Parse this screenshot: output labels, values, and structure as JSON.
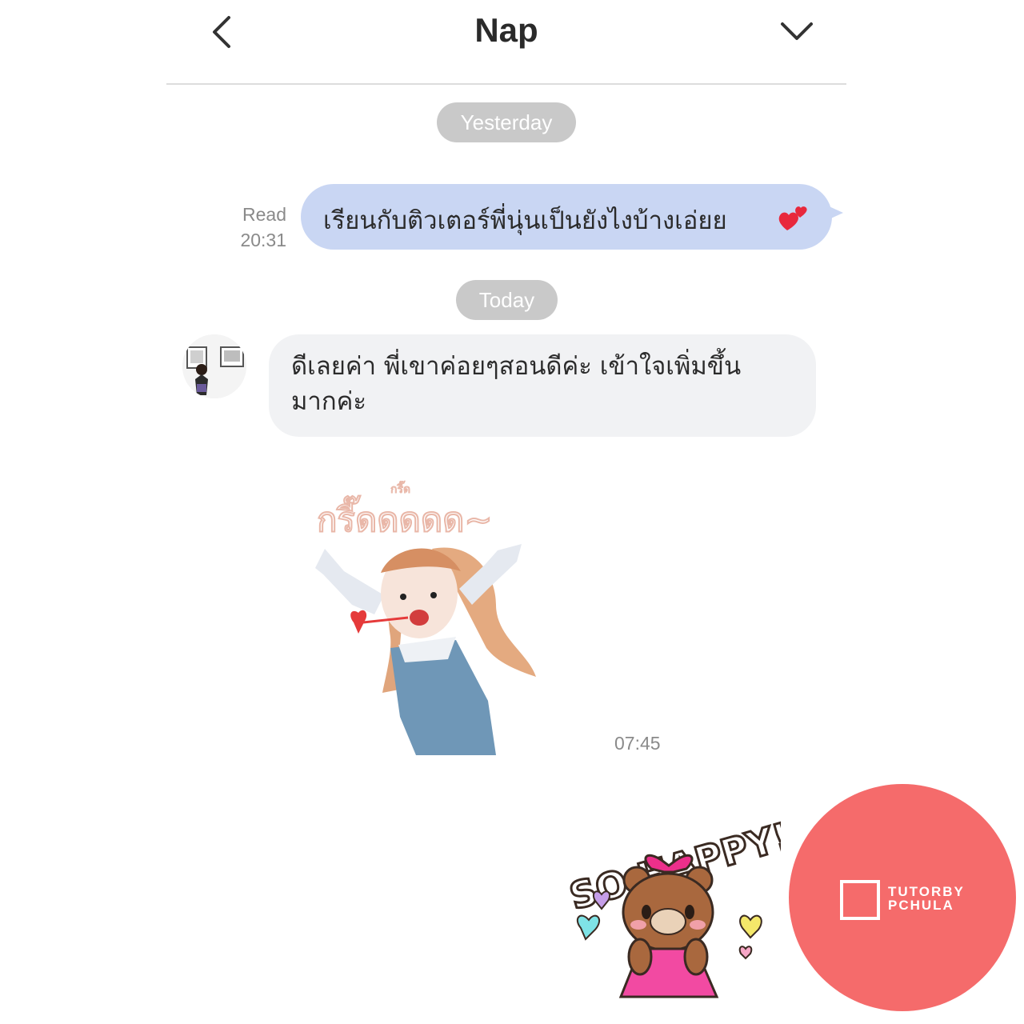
{
  "header": {
    "title": "Nap"
  },
  "dates": {
    "yesterday": "Yesterday",
    "today": "Today"
  },
  "outgoing": {
    "read_label": "Read",
    "time": "20:31",
    "text": "เรียนกับติวเตอร์พี่นุ่นเป็นยังไงบ้างเอ่ยย"
  },
  "incoming": {
    "line1": "ดีเลยค่า พี่เขาค่อยๆสอนดีค่ะ เข้าใจเพิ่มขึ้น",
    "line2": "มากค่ะ"
  },
  "sticker": {
    "girl_text": "กรี๊ดดดดด~",
    "girl_small": "กรี๊ด",
    "time": "07:45",
    "bear_text": "SO HAPPY!"
  },
  "brand": {
    "line1": "TUTORBY",
    "line2": "PCHULA"
  },
  "colors": {
    "out_bubble": "#c9d6f3",
    "in_bubble": "#f1f2f4",
    "pill": "#c9c9c9",
    "brand": "#f56b6b"
  }
}
